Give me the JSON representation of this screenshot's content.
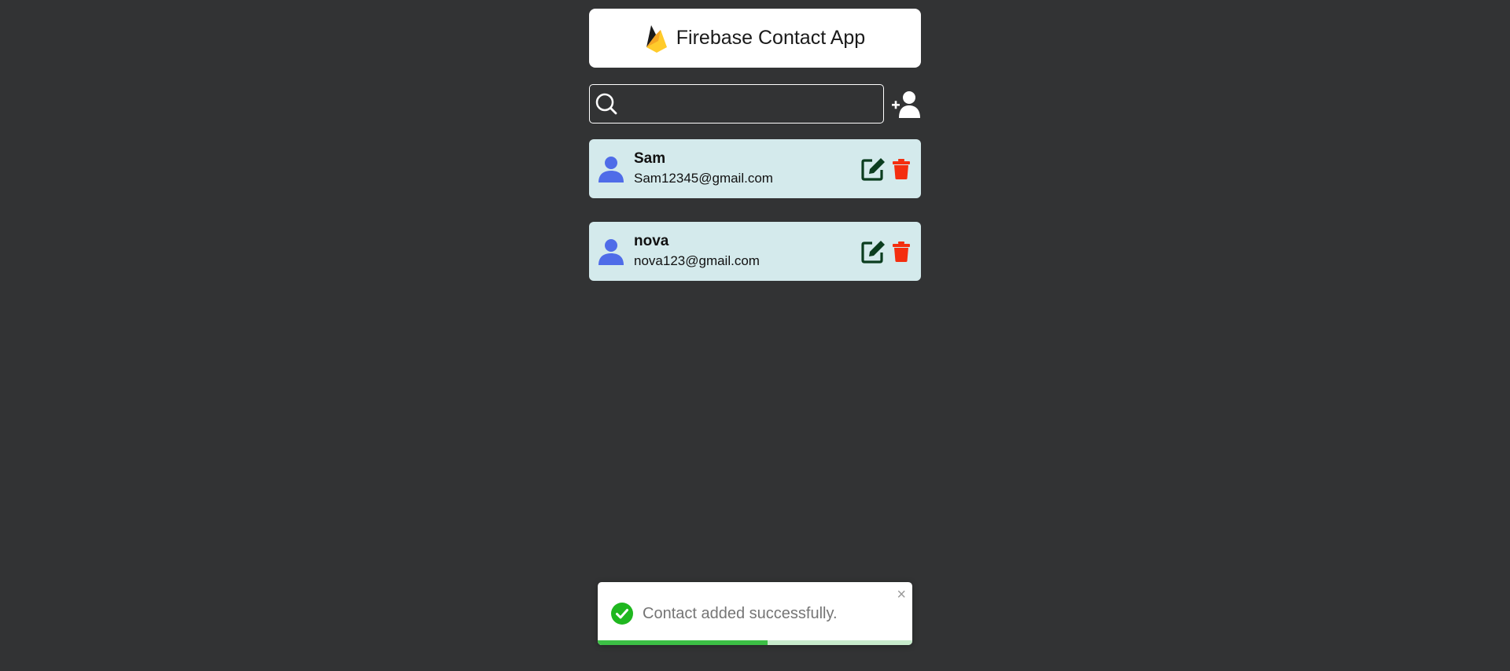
{
  "app": {
    "title": "Firebase Contact App",
    "logo_icon": "firebase-logo",
    "brand_colors": {
      "flame_dark": "#ea7e13",
      "flame_light": "#ffcb2b",
      "flame_orange": "#f5a623"
    }
  },
  "search": {
    "placeholder": "",
    "value": "",
    "icon": "search-icon"
  },
  "add_contact": {
    "icon": "add-user-icon"
  },
  "contacts": [
    {
      "name": "Sam",
      "email": "Sam12345@gmail.com"
    },
    {
      "name": "nova",
      "email": "nova123@gmail.com"
    }
  ],
  "colors": {
    "background": "#323334",
    "card": "#d4eaec",
    "avatar": "#4f6ce8",
    "edit": "#0b3d1f",
    "delete": "#f42e0f",
    "toast_success": "#3cbf45"
  },
  "toast": {
    "message": "Contact added successfully.",
    "icon": "check-circle-icon",
    "close_label": "×",
    "progress": 0.54
  }
}
